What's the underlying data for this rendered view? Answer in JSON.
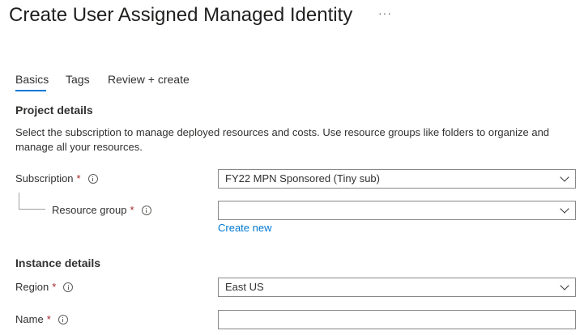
{
  "header": {
    "title": "Create User Assigned Managed Identity",
    "more_label": "···"
  },
  "tabs": [
    {
      "label": "Basics",
      "selected": true
    },
    {
      "label": "Tags",
      "selected": false
    },
    {
      "label": "Review + create",
      "selected": false
    }
  ],
  "project": {
    "heading": "Project details",
    "description": "Select the subscription to manage deployed resources and costs. Use resource groups like folders to organize and manage all your resources.",
    "subscription": {
      "label": "Subscription",
      "required": "*",
      "value": "FY22 MPN Sponsored (Tiny sub)"
    },
    "resource_group": {
      "label": "Resource group",
      "required": "*",
      "value": "",
      "create_new_label": "Create new"
    }
  },
  "instance": {
    "heading": "Instance details",
    "region": {
      "label": "Region",
      "required": "*",
      "value": "East US"
    },
    "name": {
      "label": "Name",
      "required": "*",
      "value": ""
    }
  },
  "colors": {
    "accent": "#0078d4",
    "required": "#a4262c",
    "border": "#8a8886"
  }
}
